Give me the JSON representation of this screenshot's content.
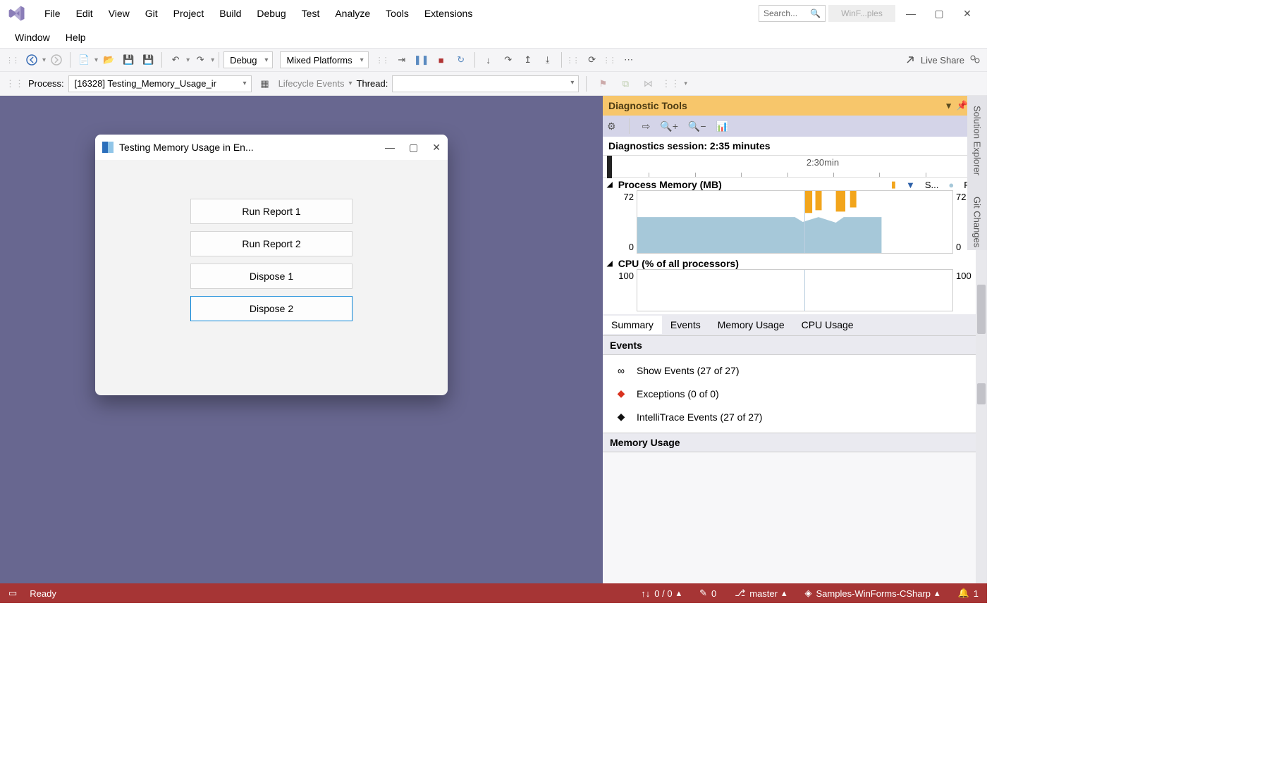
{
  "menu": {
    "items": [
      "File",
      "Edit",
      "View",
      "Git",
      "Project",
      "Build",
      "Debug",
      "Test",
      "Analyze",
      "Tools",
      "Extensions"
    ],
    "items2": [
      "Window",
      "Help"
    ]
  },
  "titlebar": {
    "search_placeholder": "Search...",
    "chip": "WinF...ples"
  },
  "toolbar": {
    "config": "Debug",
    "platform": "Mixed Platforms",
    "live_share": "Live Share"
  },
  "debugbar": {
    "process_label": "Process:",
    "process_value": "[16328] Testing_Memory_Usage_ir",
    "lifecycle_label": "Lifecycle Events",
    "thread_label": "Thread:"
  },
  "appwin": {
    "title": "Testing Memory Usage in En...",
    "buttons": [
      "Run Report 1",
      "Run Report 2",
      "Dispose 1",
      "Dispose 2"
    ]
  },
  "diag": {
    "title": "Diagnostic Tools",
    "session": "Diagnostics session: 2:35 minutes",
    "timeline_label": "2:30min",
    "timeline_end": "2:",
    "mem_header": "Process Memory (MB)",
    "mem_legend": [
      "S...",
      "Pri..."
    ],
    "cpu_header": "CPU (% of all processors)",
    "tabs": [
      "Summary",
      "Events",
      "Memory Usage",
      "CPU Usage"
    ],
    "events_header": "Events",
    "events": [
      {
        "glyph": "∞",
        "label": "Show Events (27 of 27)"
      },
      {
        "glyph": "◆",
        "color": "#d9321f",
        "label": "Exceptions (0 of 0)"
      },
      {
        "glyph": "◆",
        "color": "#111",
        "label": "IntelliTrace Events (27 of 27)"
      }
    ],
    "memory_header": "Memory Usage"
  },
  "sidetabs": [
    "Solution Explorer",
    "Git Changes"
  ],
  "statusbar": {
    "ready": "Ready",
    "errors": "0 / 0",
    "warnings": "0",
    "branch": "master",
    "repo": "Samples-WinForms-CSharp",
    "bell": "1"
  },
  "chart_data": [
    {
      "type": "area",
      "title": "Process Memory (MB)",
      "ylabel": "MB",
      "ylim": [
        0,
        72
      ],
      "x_seconds": [
        0,
        15,
        30,
        45,
        60,
        75,
        90,
        105,
        120,
        135,
        150,
        155
      ],
      "series": [
        {
          "name": "Private Bytes",
          "values": [
            42,
            42,
            42,
            42,
            42,
            42,
            42,
            36,
            42,
            38,
            42,
            42
          ],
          "color": "#a6c8d9"
        },
        {
          "name": "GC/Snapshot",
          "peaks_at_seconds": [
            105,
            112,
            125,
            132,
            135
          ],
          "peak_value": 72,
          "color": "#f2a51c"
        }
      ]
    },
    {
      "type": "line",
      "title": "CPU (% of all processors)",
      "ylabel": "%",
      "ylim": [
        0,
        100
      ],
      "x_seconds": [
        0,
        155
      ],
      "series": [
        {
          "name": "CPU",
          "values": [
            1,
            1
          ],
          "color": "#888"
        }
      ]
    }
  ]
}
